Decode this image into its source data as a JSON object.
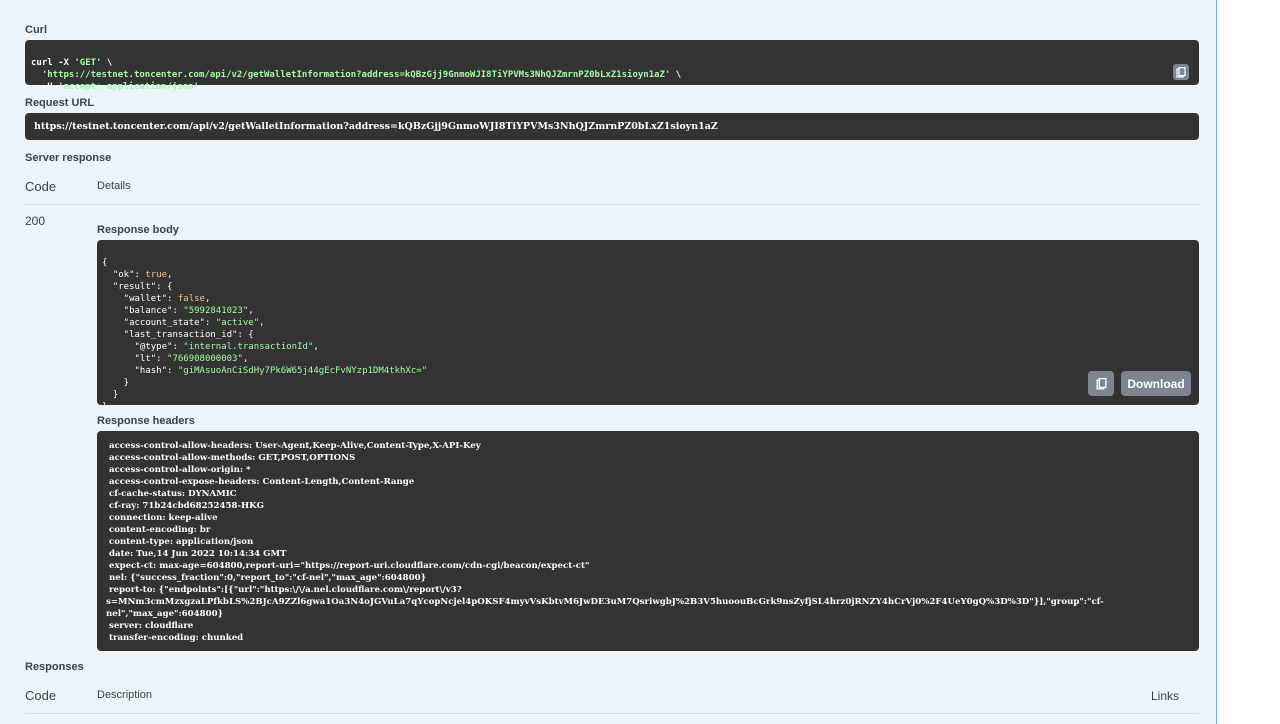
{
  "curl": {
    "label": "Curl",
    "line1": "curl -X ",
    "method": "'GET'",
    "line1_end": " \\",
    "url": "'https://testnet.toncenter.com/api/v2/getWalletInformation?address=kQBzGjj9GnmoWJI8TiYPVMs3NhQJZmrnPZ0bLxZ1sioyn1aZ'",
    "line2_end": " \\",
    "line3": "  -H ",
    "header": "'accept: application/json'"
  },
  "request_url": {
    "label": "Request URL",
    "value": "https://testnet.toncenter.com/api/v2/getWalletInformation?address=kQBzGjj9GnmoWJI8TiYPVMs3NhQJZmrnPZ0bLxZ1sioyn1aZ"
  },
  "server_response": {
    "label": "Server response",
    "code_header": "Code",
    "details_header": "Details",
    "code": "200",
    "body_label": "Response body",
    "headers_label": "Response headers",
    "download_label": "Download"
  },
  "response_body": {
    "open": "{",
    "ok_key": "  \"ok\": ",
    "ok_val": "true",
    "result_key": "  \"result\": {",
    "wallet_key": "    \"wallet\": ",
    "wallet_val": "false",
    "balance_key": "    \"balance\": ",
    "balance_val": "\"5992841023\"",
    "state_key": "    \"account_state\": ",
    "state_val": "\"active\"",
    "ltid_key": "    \"last_transaction_id\": {",
    "type_key": "      \"@type\": ",
    "type_val": "\"internal.transactionId\"",
    "lt_key": "      \"lt\": ",
    "lt_val": "\"766908000003\"",
    "hash_key": "      \"hash\": ",
    "hash_val": "\"giMAsuoAnCiSdHy7Pk6W65j44gEcFvNYzp1DM4tkhXc=\"",
    "close3": "    }",
    "close2": "  }",
    "close1": "}"
  },
  "response_headers": [
    " access-control-allow-headers: User-Agent,Keep-Alive,Content-Type,X-API-Key",
    " access-control-allow-methods: GET,POST,OPTIONS",
    " access-control-allow-origin: *",
    " access-control-expose-headers: Content-Length,Content-Range",
    " cf-cache-status: DYNAMIC",
    " cf-ray: 71b24cbd68252458-HKG",
    " connection: keep-alive",
    " content-encoding: br",
    " content-type: application/json",
    " date: Tue,14 Jun 2022 10:14:34 GMT",
    " expect-ct: max-age=604800,report-uri=\"https://report-uri.cloudflare.com/cdn-cgi/beacon/expect-ct\"",
    " nel: {\"success_fraction\":0,\"report_to\":\"cf-nel\",\"max_age\":604800}",
    " report-to: {\"endpoints\":[{\"url\":\"https:\\/\\/a.nel.cloudflare.com\\/report\\/v3?",
    "s=MNm3cmMzxgzaLPfkbLS%2BJcA9ZZl6gwa1Oa3N4oJGVuLa7qYcopNcjel4pOKSF4myvVsKbtvM6JwDE3uM7QsriwgbJ%2B3V5huoouBcGrk9nsZyfjSL4hrz0jRNZY4hCrVj0%2F4UeY0gQ%3D%3D\"}],\"group\":\"cf-",
    "nel\",\"max_age\":604800}",
    " server: cloudflare",
    " transfer-encoding: chunked"
  ],
  "responses": {
    "label": "Responses",
    "code_header": "Code",
    "description_header": "Description",
    "links_header": "Links"
  },
  "icons": {
    "copy": "copy-icon"
  },
  "colors": {
    "panel_bg": "#ebf3fb",
    "panel_border": "#61affe",
    "code_bg": "#333333",
    "string": "#a2fca2",
    "keyword": "#fcc28c",
    "button": "#7d8492"
  }
}
